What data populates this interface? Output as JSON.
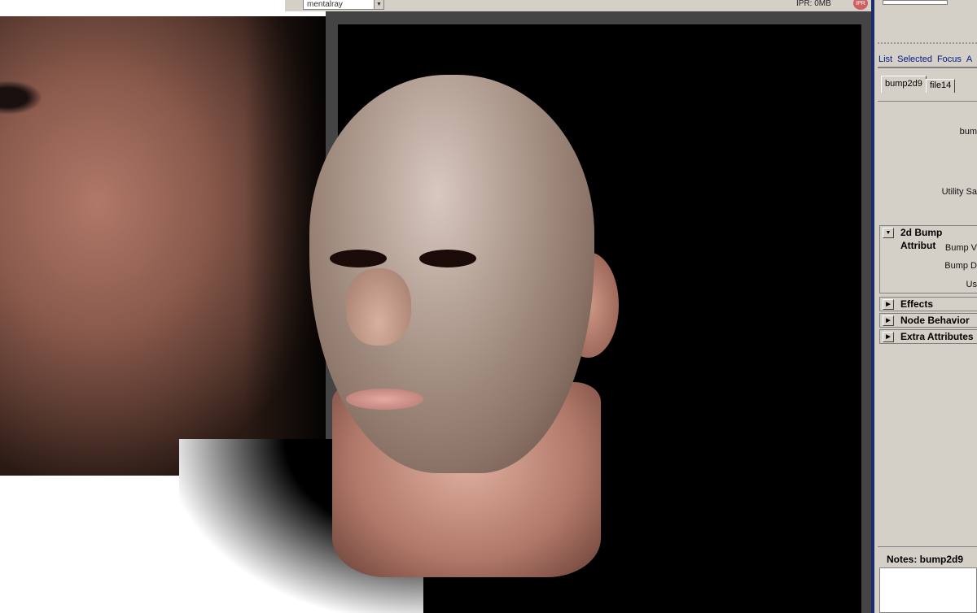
{
  "toolbar": {
    "renderer": "mentalray",
    "ipr_memory": "IPR: 0MB",
    "ipr_button": "IPR"
  },
  "attribute_editor": {
    "menu": [
      "List",
      "Selected",
      "Focus",
      "A"
    ],
    "tabs": [
      {
        "label": "bump2d9",
        "active": true
      },
      {
        "label": "file14",
        "active": false
      }
    ],
    "fields": [
      "bum",
      "Utility Sa"
    ],
    "sections": [
      {
        "label": "2d Bump Attribut",
        "expanded": true,
        "fields": [
          "Bump V",
          "Bump D",
          "Us"
        ]
      },
      {
        "label": "Effects",
        "expanded": false
      },
      {
        "label": "Node Behavior",
        "expanded": false
      },
      {
        "label": "Extra Attributes",
        "expanded": false
      }
    ],
    "notes_label": "Notes:  bump2d9"
  },
  "colors": {
    "panel": "#d4d0c8",
    "divider": "#1c2c6c",
    "viewport": "#000000"
  }
}
